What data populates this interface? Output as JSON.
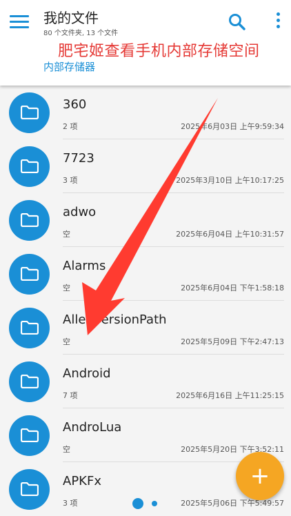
{
  "header": {
    "title": "我的文件",
    "subtitle": "80 个文件夹, 13 个文件",
    "overlay_title": "肥宅姬查看手机内部存储空间",
    "breadcrumb": "内部存储器",
    "icons": {
      "menu": "menu-icon",
      "search": "search-icon",
      "more": "more-vert-icon"
    }
  },
  "folders": [
    {
      "name": "360",
      "count": "2 项",
      "date": "2025年6月03日 上午9:59:34"
    },
    {
      "name": "7723",
      "count": "3 项",
      "date": "2025年3月10日 上午10:17:25"
    },
    {
      "name": "adwo",
      "count": "空",
      "date": "2025年6月04日 上午10:31:57"
    },
    {
      "name": "Alarms",
      "count": "空",
      "date": "2025年6月04日 下午1:58:18"
    },
    {
      "name": "AllenVersionPath",
      "count": "空",
      "date": "2025年5月09日 下午2:47:13"
    },
    {
      "name": "Android",
      "count": "7 项",
      "date": "2025年6月16日 上午11:25:15"
    },
    {
      "name": "AndroLua",
      "count": "空",
      "date": "2025年5月20日 下午3:52:11"
    },
    {
      "name": "APKFx",
      "count": "3 项",
      "date": "2025年5月06日 下午5:49:57"
    }
  ],
  "fab": {
    "label": "+"
  },
  "colors": {
    "accent": "#1a8fd6",
    "fab": "#f5a623",
    "annotation": "#e53935"
  }
}
